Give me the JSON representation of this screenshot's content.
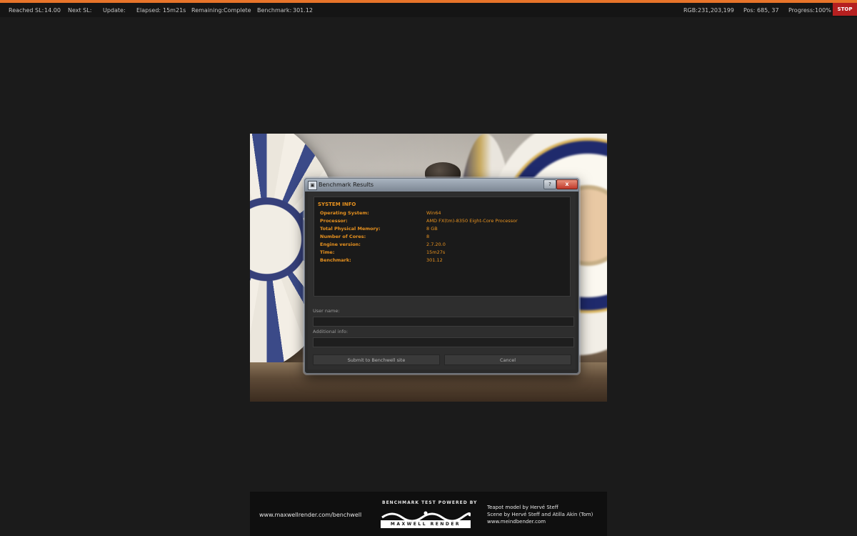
{
  "top_bar": {
    "reached_sl_label": "Reached SL:",
    "reached_sl_value": "14.00",
    "next_sl_label": "Next SL:",
    "update_label": "Update:",
    "elapsed_label": "Elapsed:",
    "elapsed_value": "15m21s",
    "remaining_label": "Remaining:",
    "remaining_value": "Complete",
    "benchmark_label": "Benchmark:",
    "benchmark_value": "301.12",
    "rgb_label": "RGB:",
    "rgb_value": "231,203,199",
    "pos_label": "Pos:",
    "pos_value": "685, 37",
    "progress_label": "Progress:",
    "progress_value": "100%",
    "stop_label": "STOP",
    "accent_color": "#e8742a"
  },
  "dialog": {
    "title": "Benchmark Results",
    "help_label": "?",
    "close_label": "x",
    "system_info": {
      "heading": "SYSTEM INFO",
      "rows": [
        {
          "key": "Operating System:",
          "value": "Win64"
        },
        {
          "key": "Processor:",
          "value": "AMD FX(tm)-8350 Eight-Core Processor"
        },
        {
          "key": "Total Physical Memory:",
          "value": "8 GB"
        },
        {
          "key": "Number of Cores:",
          "value": "8"
        },
        {
          "key": "Engine version:",
          "value": "2.7.20.0"
        },
        {
          "key": "Time:",
          "value": "15m27s"
        },
        {
          "key": "Benchmark:",
          "value": "301.12"
        }
      ],
      "text_color": "#e8921f"
    },
    "user_name_label": "User name:",
    "user_name_value": "",
    "additional_info_label": "Additional info:",
    "additional_info_value": "",
    "submit_label": "Submit to Benchwell site",
    "cancel_label": "Cancel"
  },
  "footer": {
    "url": "www.maxwellrender.com/benchwell",
    "powered_by": "BENCHMARK TEST POWERED BY",
    "logo_text": "MAXWELL RENDER",
    "credit_1": "Teapot model by Hervé Steff",
    "credit_2": "Scene by Hervé Steff and Atilla Akin (Tom)",
    "credit_3": "www.meindbender.com"
  }
}
